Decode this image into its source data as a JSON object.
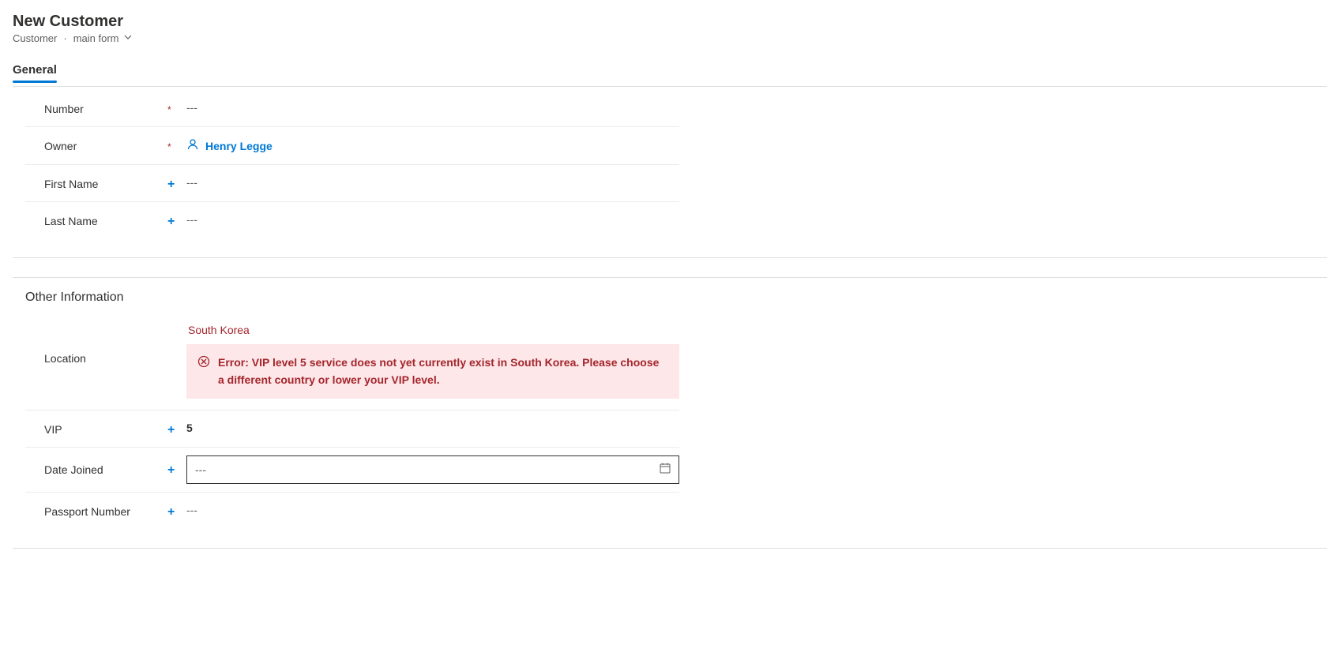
{
  "header": {
    "title": "New Customer",
    "entity": "Customer",
    "form_name": "main form"
  },
  "tabs": {
    "general": "General"
  },
  "fields": {
    "number": {
      "label": "Number",
      "placeholder": "---"
    },
    "owner": {
      "label": "Owner",
      "value": "Henry Legge"
    },
    "first_name": {
      "label": "First Name",
      "placeholder": "---"
    },
    "last_name": {
      "label": "Last Name",
      "placeholder": "---"
    }
  },
  "section2": {
    "title": "Other Information",
    "location": {
      "label": "Location",
      "value": "South Korea",
      "error": "Error: VIP level 5 service does not yet currently exist in South Korea. Please choose a different country or lower your VIP level."
    },
    "vip": {
      "label": "VIP",
      "value": "5"
    },
    "date_joined": {
      "label": "Date Joined",
      "placeholder": "---"
    },
    "passport": {
      "label": "Passport Number",
      "placeholder": "---"
    }
  }
}
